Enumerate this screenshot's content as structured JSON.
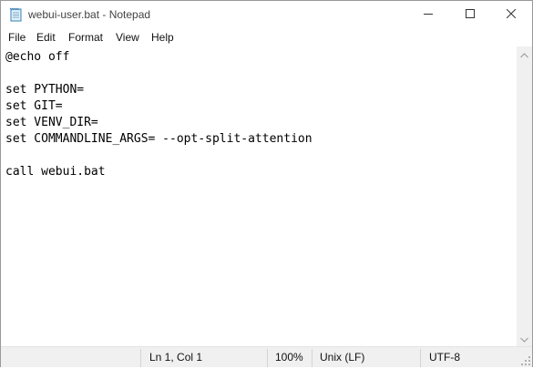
{
  "window": {
    "title": "webui-user.bat - Notepad",
    "app_icon": "notepad-icon"
  },
  "caption_buttons": {
    "minimize_icon": "minimize-icon",
    "maximize_icon": "maximize-icon",
    "close_icon": "close-icon"
  },
  "menu": {
    "items": [
      {
        "label": "File"
      },
      {
        "label": "Edit"
      },
      {
        "label": "Format"
      },
      {
        "label": "View"
      },
      {
        "label": "Help"
      }
    ]
  },
  "editor": {
    "lines": [
      "@echo off",
      "",
      "set PYTHON=",
      "set GIT=",
      "set VENV_DIR=",
      "set COMMANDLINE_ARGS= --opt-split-attention",
      "",
      "call webui.bat"
    ]
  },
  "statusbar": {
    "position": "Ln 1, Col 1",
    "zoom": "100%",
    "line_ending": "Unix (LF)",
    "encoding": "UTF-8"
  },
  "colors": {
    "background": "#ffffff",
    "chrome": "#f0f0f0",
    "text": "#000000"
  }
}
